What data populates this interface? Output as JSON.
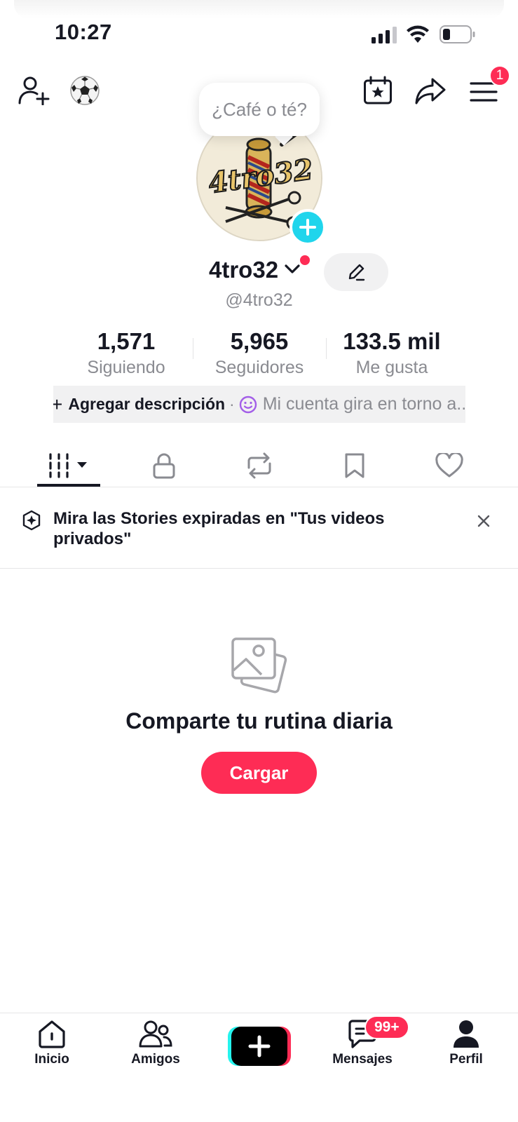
{
  "status_bar": {
    "time": "10:27",
    "icons": [
      "cellular-signal-icon",
      "wifi-icon",
      "battery-icon"
    ]
  },
  "header": {
    "left_icons": [
      "add-friend-icon",
      "soccer-ball-icon"
    ],
    "right_icons": [
      "calendar-star-icon",
      "share-icon",
      "menu-icon"
    ],
    "menu_badge": "1",
    "tooltip": "¿Café o té?"
  },
  "profile": {
    "avatar_text": "4tro32",
    "username": "4tro32",
    "handle": "@4tro32",
    "stats": [
      {
        "value": "1,571",
        "label": "Siguiendo"
      },
      {
        "value": "5,965",
        "label": "Seguidores"
      },
      {
        "value": "133.5 mil",
        "label": "Me gusta"
      }
    ],
    "description": {
      "plus": "+",
      "add_label": "Agregar descripción",
      "separator": "·",
      "placeholder": "Mi cuenta gira en torno a.."
    }
  },
  "tabs": [
    "videos-grid-icon",
    "lock-icon",
    "repost-icon",
    "bookmark-icon",
    "heart-icon"
  ],
  "stories_banner": {
    "text": "Mira las Stories expiradas en \"Tus videos privados\""
  },
  "empty_state": {
    "title": "Comparte tu rutina diaria",
    "button": "Cargar"
  },
  "bottom_nav": {
    "items": [
      {
        "label": "Inicio",
        "icon": "home-icon"
      },
      {
        "label": "Amigos",
        "icon": "friends-icon"
      },
      {
        "label": "",
        "icon": "create-plus-icon"
      },
      {
        "label": "Mensajes",
        "icon": "messages-icon"
      },
      {
        "label": "Perfil",
        "icon": "profile-icon"
      }
    ],
    "messages_badge": "99+"
  },
  "colors": {
    "accent_red": "#fe2c55",
    "accent_cyan": "#20d5ec",
    "text_primary": "#161823",
    "text_secondary": "#8a8b91"
  }
}
